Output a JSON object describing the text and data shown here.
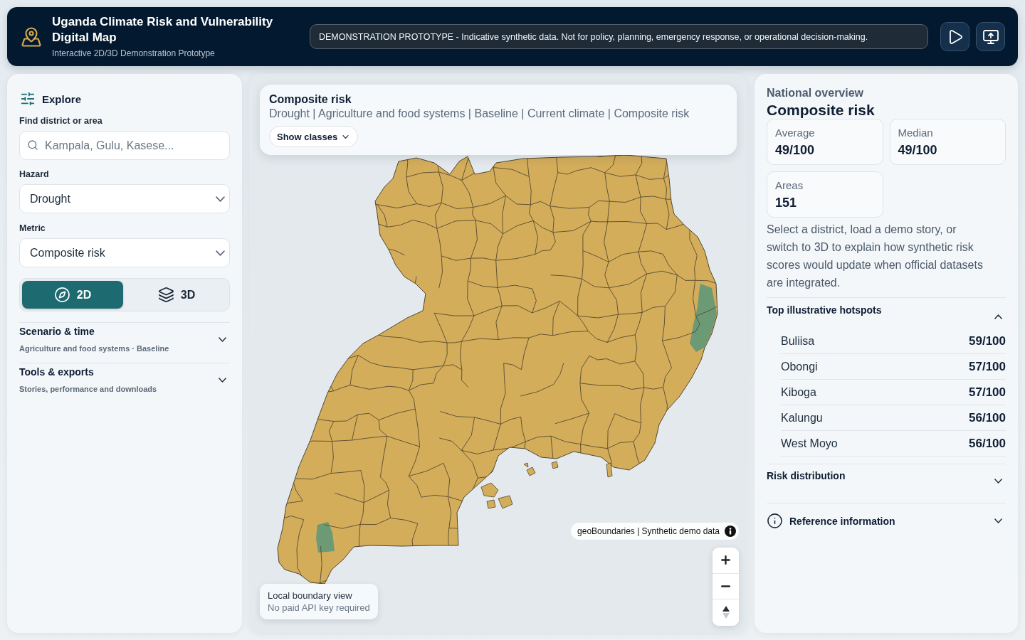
{
  "header": {
    "title": "Uganda Climate Risk and Vulnerability Digital Map",
    "subtitle": "Interactive 2D/3D Demonstration Prototype",
    "notice": "DEMONSTRATION PROTOTYPE - Indicative synthetic data. Not for policy, planning, emergency response, or operational decision-making."
  },
  "sidebar": {
    "title": "Explore",
    "search": {
      "label": "Find district or area",
      "placeholder": "Kampala, Gulu, Kasese..."
    },
    "selects": [
      {
        "label": "Hazard",
        "value": "Drought"
      },
      {
        "label": "Metric",
        "value": "Composite risk"
      }
    ],
    "view_modes": [
      {
        "label": "2D",
        "kind": "flat",
        "selected": true
      },
      {
        "label": "3D",
        "kind": "layers",
        "selected": false
      }
    ],
    "sections": [
      {
        "title": "Scenario & time",
        "summary": "Agriculture and food systems · Baseline",
        "expanded": false
      },
      {
        "title": "Tools & exports",
        "summary": "Stories, performance and downloads",
        "expanded": false
      }
    ]
  },
  "map": {
    "legend": {
      "title": "Composite risk",
      "subtitle": "Drought | Agriculture and food systems | Baseline | Current climate | Composite risk",
      "button": "Show classes",
      "expanded": false
    },
    "attribution": "geoBoundaries | Synthetic demo data",
    "footer": {
      "title": "Local boundary view",
      "note": "No paid API key required"
    }
  },
  "overview": {
    "eyebrow": "National overview",
    "title": "Composite risk",
    "stats": [
      {
        "label": "Average",
        "value": "49/100"
      },
      {
        "label": "Median",
        "value": "49/100"
      },
      {
        "label": "Areas",
        "value": "151"
      }
    ],
    "description": "Select a district, load a demo story, or switch to 3D to explain how synthetic risk scores would update when official datasets are integrated.",
    "hotspots": {
      "title": "Top illustrative hotspots",
      "expanded": true,
      "items": [
        {
          "name": "Buliisa",
          "score": "59/100"
        },
        {
          "name": "Obongi",
          "score": "57/100"
        },
        {
          "name": "Kiboga",
          "score": "57/100"
        },
        {
          "name": "Kalungu",
          "score": "56/100"
        },
        {
          "name": "West Moyo",
          "score": "56/100"
        }
      ]
    },
    "sections": [
      {
        "title": "Risk distribution",
        "kind": "plain",
        "expanded": false
      },
      {
        "title": "Reference information",
        "kind": "info",
        "expanded": false
      }
    ]
  }
}
